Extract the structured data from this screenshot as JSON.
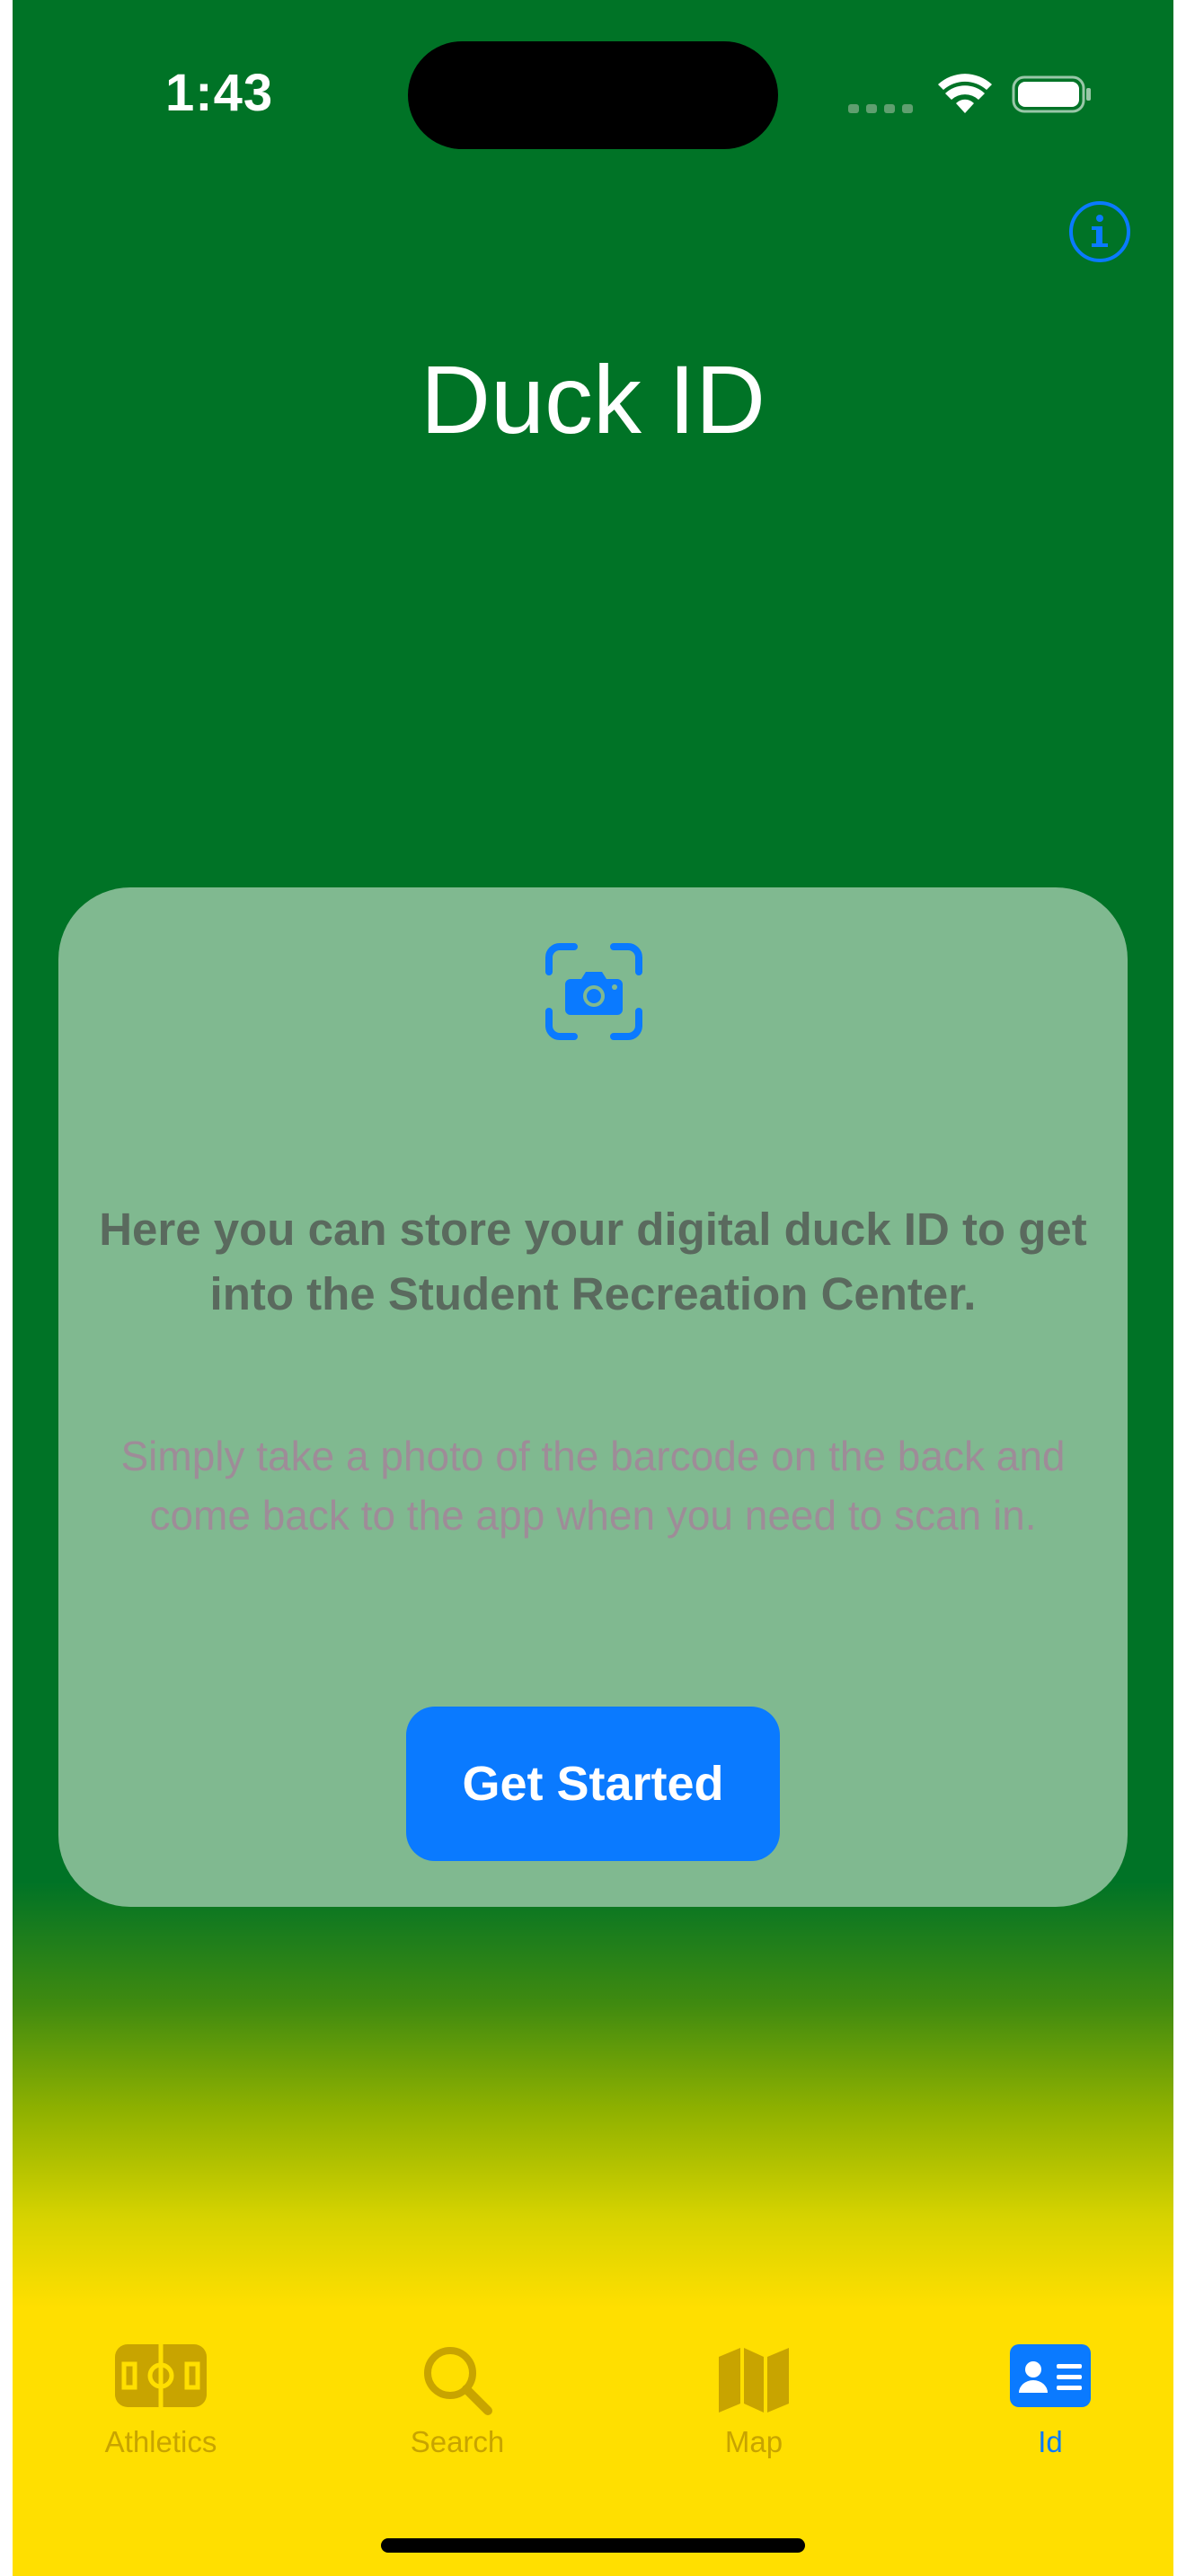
{
  "status_bar": {
    "time": "1:43"
  },
  "header": {
    "title": "Duck ID",
    "info_icon": "info-circle-icon"
  },
  "card": {
    "icon": "camera-viewfinder-icon",
    "heading": "Here you can store your digital duck ID to get into the Student Recreation Center.",
    "body": "Simply take a photo of the barcode on the back and come back to the app when you need to scan in.",
    "button_label": "Get Started"
  },
  "tab_bar": {
    "tabs": [
      {
        "label": "Athletics",
        "icon": "sports-field-icon",
        "active": false
      },
      {
        "label": "Search",
        "icon": "magnifying-glass-icon",
        "active": false
      },
      {
        "label": "Map",
        "icon": "map-icon",
        "active": false
      },
      {
        "label": "Id",
        "icon": "id-card-icon",
        "active": true
      }
    ]
  },
  "colors": {
    "background_top": "#007326",
    "background_bottom": "#ffdf00",
    "card": "#80b990",
    "accent": "#0a7aff",
    "inactive_tab": "#c8a400"
  }
}
